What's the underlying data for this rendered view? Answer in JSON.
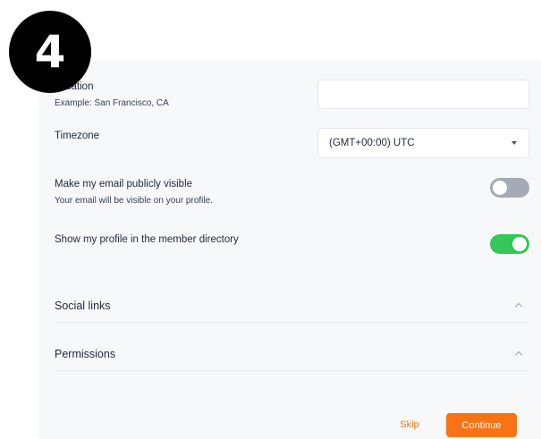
{
  "step_number": "4",
  "location": {
    "label": "Location",
    "hint": "Example: San Francisco, CA",
    "value": ""
  },
  "timezone": {
    "label": "Timezone",
    "value": "(GMT+00:00) UTC"
  },
  "email_visible": {
    "label": "Make my email publicly visible",
    "hint": "Your email will be visible on your profile.",
    "enabled": false
  },
  "directory": {
    "label": "Show my profile in the member directory",
    "enabled": true
  },
  "sections": {
    "social": "Social links",
    "permissions": "Permissions"
  },
  "actions": {
    "skip": "Skip",
    "continue": "Continue"
  },
  "colors": {
    "accent": "#f97316",
    "toggle_on": "#34c759",
    "toggle_off": "#a4abb7"
  }
}
